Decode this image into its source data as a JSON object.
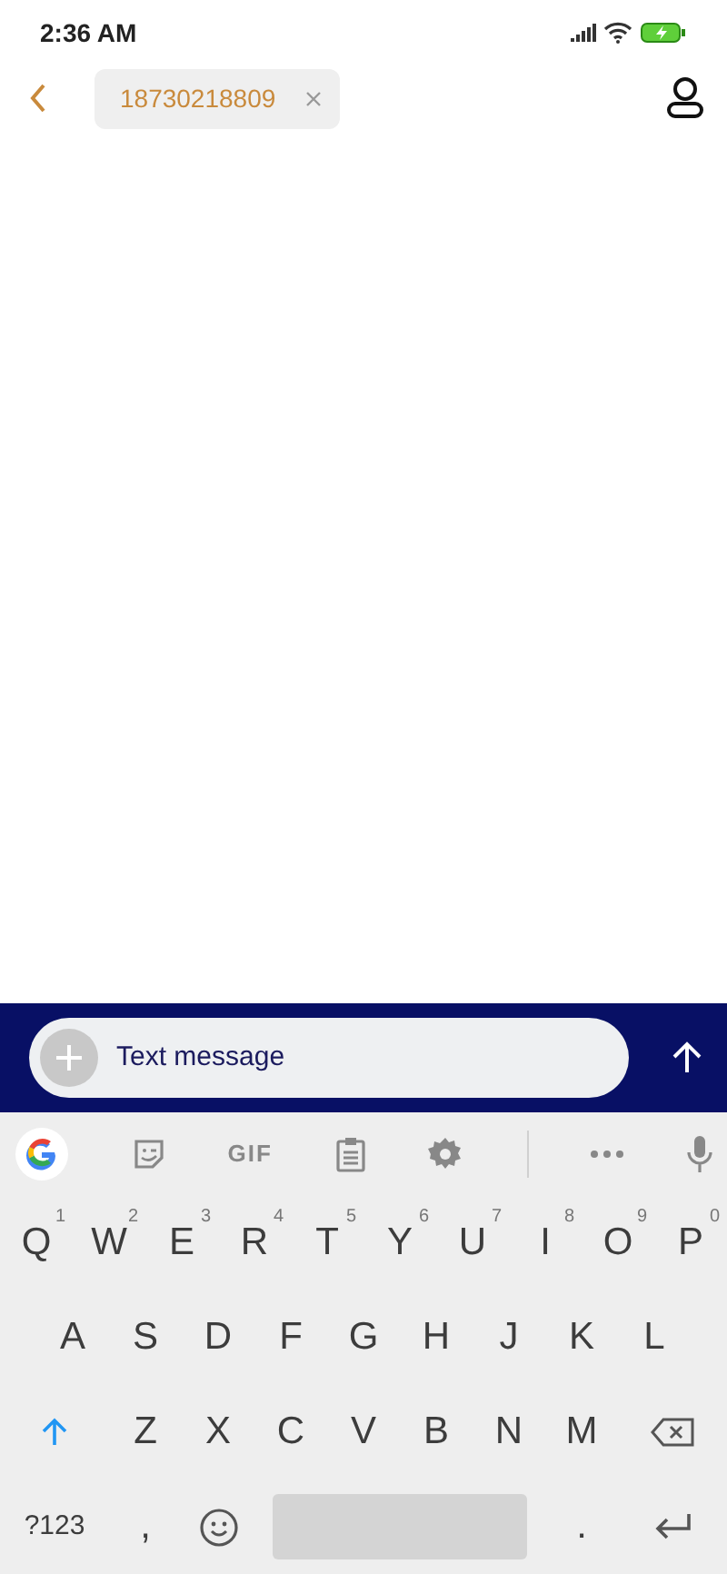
{
  "status_bar": {
    "time": "2:36 AM"
  },
  "header": {
    "recipient": "18730218809"
  },
  "compose": {
    "placeholder": "Text message"
  },
  "keyboard_toolbar": {
    "gif_label": "GIF"
  },
  "keyboard": {
    "shift": {
      "on": true
    },
    "rows": [
      {
        "keys": [
          {
            "kind": "letter",
            "label": "Q",
            "hint": "1"
          },
          {
            "kind": "letter",
            "label": "W",
            "hint": "2"
          },
          {
            "kind": "letter",
            "label": "E",
            "hint": "3"
          },
          {
            "kind": "letter",
            "label": "R",
            "hint": "4"
          },
          {
            "kind": "letter",
            "label": "T",
            "hint": "5"
          },
          {
            "kind": "letter",
            "label": "Y",
            "hint": "6"
          },
          {
            "kind": "letter",
            "label": "U",
            "hint": "7"
          },
          {
            "kind": "letter",
            "label": "I",
            "hint": "8"
          },
          {
            "kind": "letter",
            "label": "O",
            "hint": "9"
          },
          {
            "kind": "letter",
            "label": "P",
            "hint": "0"
          }
        ]
      },
      {
        "keys": [
          {
            "kind": "letter",
            "label": "A"
          },
          {
            "kind": "letter",
            "label": "S"
          },
          {
            "kind": "letter",
            "label": "D"
          },
          {
            "kind": "letter",
            "label": "F"
          },
          {
            "kind": "letter",
            "label": "G"
          },
          {
            "kind": "letter",
            "label": "H"
          },
          {
            "kind": "letter",
            "label": "J"
          },
          {
            "kind": "letter",
            "label": "K"
          },
          {
            "kind": "letter",
            "label": "L"
          }
        ]
      },
      {
        "keys": [
          {
            "kind": "shift"
          },
          {
            "kind": "letter",
            "label": "Z"
          },
          {
            "kind": "letter",
            "label": "X"
          },
          {
            "kind": "letter",
            "label": "C"
          },
          {
            "kind": "letter",
            "label": "V"
          },
          {
            "kind": "letter",
            "label": "B"
          },
          {
            "kind": "letter",
            "label": "N"
          },
          {
            "kind": "letter",
            "label": "M"
          },
          {
            "kind": "backspace"
          }
        ]
      },
      {
        "keys": [
          {
            "kind": "symbols",
            "label": "?123"
          },
          {
            "kind": "letter",
            "label": ","
          },
          {
            "kind": "emoji"
          },
          {
            "kind": "space"
          },
          {
            "kind": "letter",
            "label": "."
          },
          {
            "kind": "enter"
          }
        ]
      }
    ]
  }
}
